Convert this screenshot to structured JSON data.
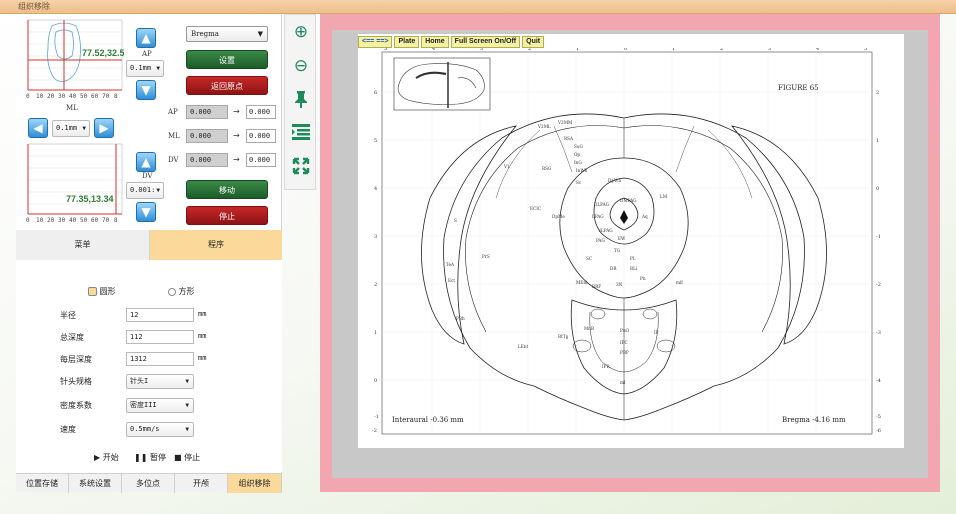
{
  "window": {
    "title": "组织移除"
  },
  "graph_top": {
    "label": "77.52,32.59",
    "x_ticks": [
      "0",
      "10",
      "20",
      "30",
      "40",
      "50",
      "60",
      "70",
      "8"
    ],
    "xlabel": "ML"
  },
  "graph_bottom": {
    "label": "77.35,13.34",
    "x_ticks": [
      "0",
      "10",
      "20",
      "30",
      "40",
      "50",
      "60",
      "70",
      "8"
    ]
  },
  "atlas_select": {
    "value": "Bregma"
  },
  "ap": {
    "label": "AP",
    "step": "0.1mm"
  },
  "ml": {
    "label": "ML",
    "step": "0.1mm"
  },
  "dv": {
    "label": "DV",
    "step": "0.001:"
  },
  "buttons": {
    "set": "设置",
    "return_origin": "返回原点",
    "move": "移动",
    "stop": "停止"
  },
  "coords": [
    {
      "axis": "AP",
      "current": "0.000",
      "arrow": "→",
      "target": "0.000"
    },
    {
      "axis": "ML",
      "current": "0.000",
      "arrow": "→",
      "target": "0.000"
    },
    {
      "axis": "DV",
      "current": "0.000",
      "arrow": "→",
      "target": "0.000"
    }
  ],
  "tabs_top": {
    "menu": "菜单",
    "program": "程序"
  },
  "form": {
    "shape_circle": "圆形",
    "shape_square": "方形",
    "radius_label": "半径",
    "radius_value": "12",
    "radius_unit": "mm",
    "total_depth_label": "总深度",
    "total_depth_value": "112",
    "total_depth_unit": "mm",
    "layer_depth_label": "每层深度",
    "layer_depth_value": "1312",
    "layer_depth_unit": "mm",
    "needle_label": "针头规格",
    "needle_value": "针头I",
    "density_label": "密度系数",
    "density_value": "密度III",
    "speed_label": "速度",
    "speed_value": "0.5mm/s"
  },
  "controls": {
    "start": "开始",
    "pause": "暂停",
    "stop": "停止"
  },
  "bottom_tabs": [
    "位置存储",
    "系统设置",
    "多位点",
    "开颅",
    "组织移除"
  ],
  "toolbar": [
    "zoom-in-icon",
    "zoom-out-icon",
    "pin-icon",
    "list-icon",
    "fullscreen-icon"
  ],
  "viewer": {
    "nav": [
      "<== ==>",
      "Plate",
      "Home",
      "Full Screen On/Off",
      "Quit"
    ],
    "figure": "FIGURE 65",
    "interaural": "Interaural -0.36 mm",
    "bregma": "Bregma -4.16 mm",
    "top_ticks": [
      "5",
      "4",
      "3",
      "2",
      "1",
      "0",
      "1",
      "2",
      "3",
      "4",
      "5"
    ],
    "left_ticks": [
      "6",
      "5",
      "4",
      "3",
      "2",
      "1",
      "0",
      "-1",
      "-2"
    ],
    "right_ticks": [
      "2",
      "1",
      "0",
      "-1",
      "-2",
      "-3",
      "-4",
      "-5",
      "-6"
    ],
    "regions": [
      "V2ML",
      "V2MM",
      "RSA",
      "V1",
      "RSG",
      "DpWh",
      "DLPAG",
      "DMPAG",
      "LPAG",
      "Aq",
      "VLPAG",
      "PAG",
      "EW",
      "SuG",
      "Op",
      "InG",
      "InWh",
      "Sc",
      "SC",
      "DpMe",
      "ECIC",
      "PrS",
      "S",
      "TeA",
      "Ect",
      "PRh",
      "LEnt",
      "MEnt",
      "RRF",
      "PBP",
      "MnR",
      "PnO",
      "IPC",
      "IPR",
      "RtTg",
      "PL",
      "ml",
      "Pn",
      "mlf",
      "LM",
      "TG",
      "DR",
      "RLi",
      "3N",
      "IF",
      "VTA"
    ]
  },
  "colors": {
    "accent_green": "#1d5c2a",
    "accent_red": "#b71c1c",
    "tab_active": "#fbd99a",
    "viewer_bg": "#f2a6b0",
    "blue_arrow": "#2f8fd8"
  }
}
